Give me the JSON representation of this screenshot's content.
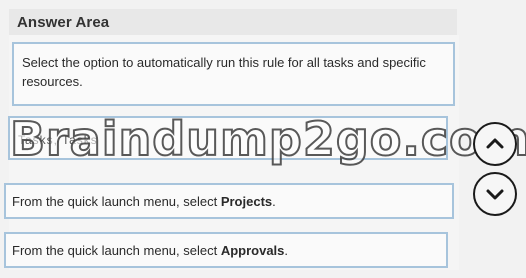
{
  "header": {
    "title": "Answer Area"
  },
  "items": [
    {
      "text": "Select the option to automatically run this rule for all tasks and specific resources."
    },
    {
      "text_partial": "Tasks, Tasks"
    },
    {
      "prefix": "From the quick launch menu, select ",
      "bold": "Projects",
      "suffix": "."
    },
    {
      "prefix": "From the quick launch menu, select ",
      "bold": "Approvals",
      "suffix": "."
    }
  ],
  "watermark": "Braindump2go.com",
  "controls": {
    "up": "chevron-up-icon",
    "down": "chevron-down-icon"
  }
}
